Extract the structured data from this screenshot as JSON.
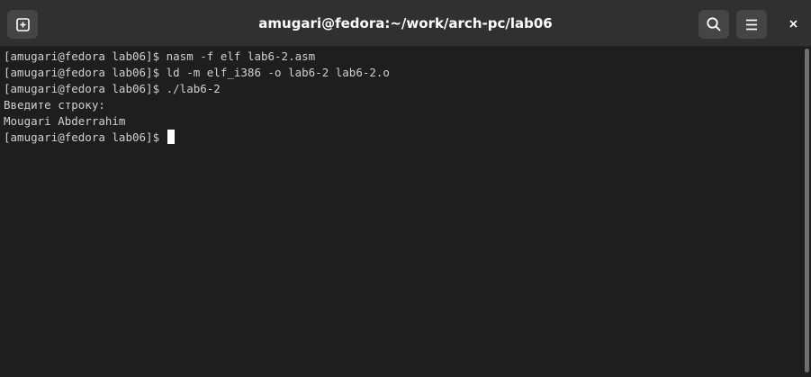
{
  "window": {
    "title": "amugari@fedora:~/work/arch-pc/lab06"
  },
  "header": {
    "new_tab_icon": "new-tab-icon",
    "search_icon": "search-icon",
    "menu_icon": "hamburger-menu-icon",
    "close_icon": "close-icon"
  },
  "terminal": {
    "lines": [
      "[amugari@fedora lab06]$ nasm -f elf lab6-2.asm",
      "[amugari@fedora lab06]$ ld -m elf_i386 -o lab6-2 lab6-2.o",
      "[amugari@fedora lab06]$ ./lab6-2",
      "Введите строку:",
      "Mougari Abderrahim"
    ],
    "prompt": "[amugari@fedora lab06]$ "
  },
  "colors": {
    "background": "#1e1e1e",
    "headerbar": "#303030",
    "text": "#d0d0d0",
    "cursor": "#ffffff"
  }
}
